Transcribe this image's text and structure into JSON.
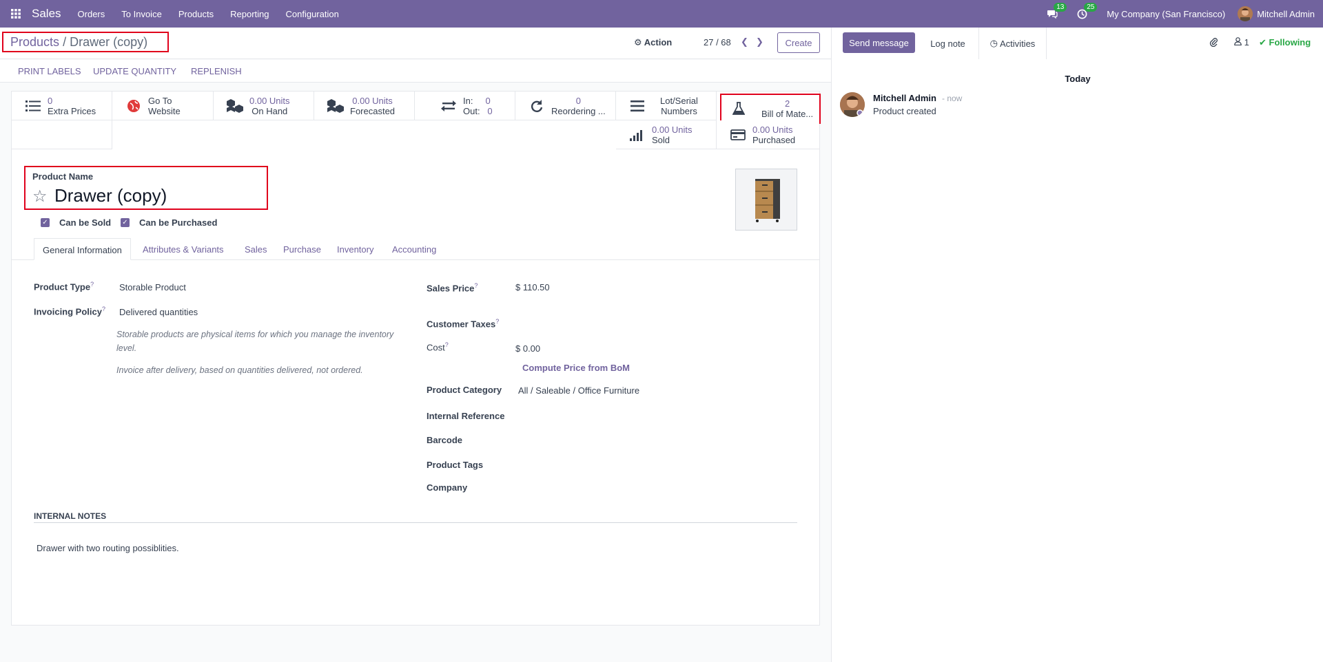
{
  "navbar": {
    "app_name": "Sales",
    "menus": [
      "Orders",
      "To Invoice",
      "Products",
      "Reporting",
      "Configuration"
    ],
    "messages_count": "13",
    "activities_count": "25",
    "company": "My Company (San Francisco)",
    "user": "Mitchell Admin"
  },
  "control_panel": {
    "breadcrumb_parent": "Products",
    "breadcrumb_sep": "/",
    "breadcrumb_current": "Drawer (copy)",
    "action_label": "Action",
    "pager": "27 / 68",
    "create_label": "Create"
  },
  "header_buttons": [
    "PRINT LABELS",
    "UPDATE QUANTITY",
    "REPLENISH"
  ],
  "smart_buttons": {
    "extra_prices": {
      "value": "0",
      "label": "Extra Prices"
    },
    "website": {
      "line1": "Go To",
      "line2": "Website"
    },
    "on_hand": {
      "value": "0.00 Units",
      "label": "On Hand"
    },
    "forecasted": {
      "value": "0.00 Units",
      "label": "Forecasted"
    },
    "in_out": {
      "in_label": "In:",
      "in_value": "0",
      "out_label": "Out:",
      "out_value": "0"
    },
    "reordering": {
      "value": "0",
      "label": "Reordering ..."
    },
    "lot_serial": {
      "line1": "Lot/Serial",
      "line2": "Numbers"
    },
    "bom": {
      "value": "2",
      "label": "Bill of Mate..."
    },
    "sold": {
      "value": "0.00 Units",
      "label": "Sold"
    },
    "purchased": {
      "value": "0.00 Units",
      "label": "Purchased"
    }
  },
  "product": {
    "name_label": "Product Name",
    "name": "Drawer (copy)",
    "can_be_sold": "Can be Sold",
    "can_be_purchased": "Can be Purchased"
  },
  "tabs": [
    "General Information",
    "Attributes & Variants",
    "Sales",
    "Purchase",
    "Inventory",
    "Accounting"
  ],
  "general": {
    "product_type_label": "Product Type",
    "product_type": "Storable Product",
    "invoicing_policy_label": "Invoicing Policy",
    "invoicing_policy": "Delivered quantities",
    "help_storable_1": "Storable products are physical items for which you manage the inventory",
    "help_storable_2": "level.",
    "help_invoice": "Invoice after delivery, based on quantities delivered, not ordered.",
    "sales_price_label": "Sales Price",
    "sales_price": "$ 110.50",
    "customer_taxes_label": "Customer Taxes",
    "cost_label": "Cost",
    "cost": "$ 0.00",
    "compute_bom": "Compute Price from BoM",
    "category_label": "Product Category",
    "category": "All / Saleable / Office Furniture",
    "internal_ref_label": "Internal Reference",
    "barcode_label": "Barcode",
    "tags_label": "Product Tags",
    "company_label": "Company",
    "help_mark": "?"
  },
  "notes": {
    "title": "INTERNAL NOTES",
    "text": "Drawer with two routing possiblities."
  },
  "chatter": {
    "send_message": "Send message",
    "log_note": "Log note",
    "activities": "Activities",
    "followers_count": "1",
    "following": "Following",
    "today": "Today",
    "author": "Mitchell Admin",
    "time": "- now",
    "body": "Product created"
  }
}
